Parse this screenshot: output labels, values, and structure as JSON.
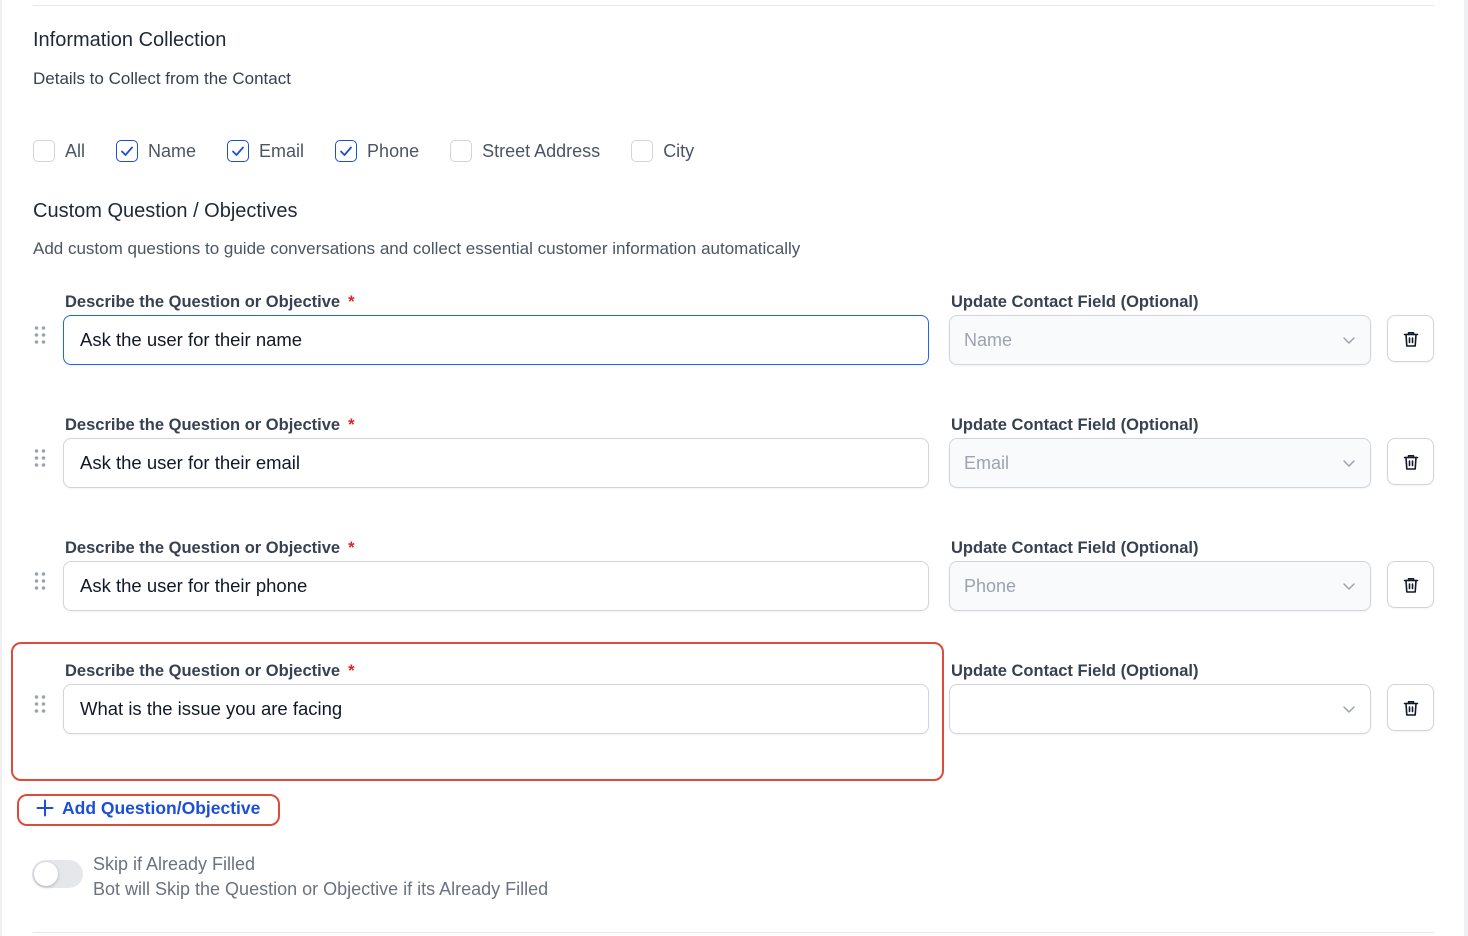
{
  "info": {
    "title": "Information Collection",
    "subtitle": "Details to Collect from the Contact",
    "fields": [
      {
        "label": "All",
        "checked": false
      },
      {
        "label": "Name",
        "checked": true
      },
      {
        "label": "Email",
        "checked": true
      },
      {
        "label": "Phone",
        "checked": true
      },
      {
        "label": "Street Address",
        "checked": false
      },
      {
        "label": "City",
        "checked": false
      }
    ]
  },
  "custom": {
    "title": "Custom Question / Objectives",
    "description": "Add custom questions to guide conversations and collect essential customer information automatically",
    "question_label": "Describe the Question or Objective",
    "required_mark": "*",
    "field_label": "Update Contact Field (Optional)",
    "questions": [
      {
        "value": "Ask the user for their name",
        "field": "Name"
      },
      {
        "value": "Ask the user for their email",
        "field": "Email"
      },
      {
        "value": "Ask the user for their phone",
        "field": "Phone"
      },
      {
        "value": "What is the issue you are facing",
        "field": ""
      }
    ],
    "add_label": "Add Question/Objective"
  },
  "skip": {
    "title": "Skip if Already Filled",
    "description": "Bot will Skip the Question or Objective if its Already Filled",
    "enabled": false
  },
  "colors": {
    "accent": "#1d4ed8",
    "highlight": "#dc4c3a",
    "required": "#dc2626"
  }
}
